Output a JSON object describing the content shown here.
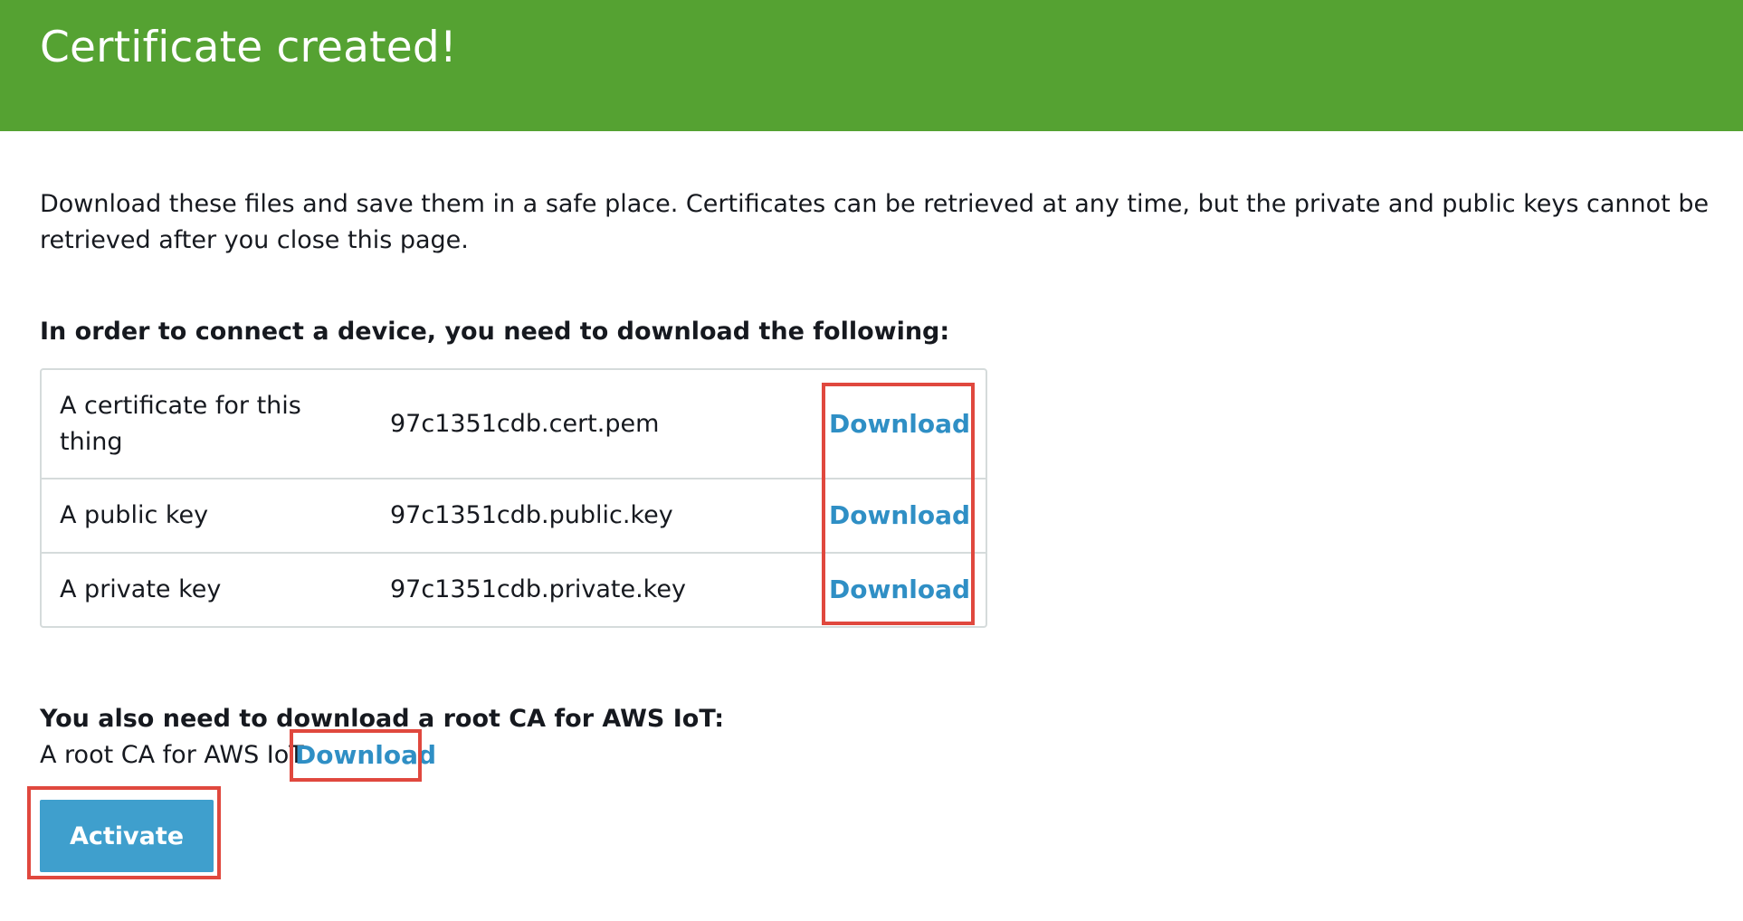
{
  "banner": {
    "title": "Certificate created!"
  },
  "intro": {
    "text": "Download these files and save them in a safe place. Certificates can be retrieved at any time, but the private and public keys cannot be retrieved after you close this page."
  },
  "device_section": {
    "heading": "In order to connect a device, you need to download the following:",
    "rows": [
      {
        "description": "A certificate for this thing",
        "filename": "97c1351cdb.cert.pem",
        "link": "Download"
      },
      {
        "description": "A public key",
        "filename": "97c1351cdb.public.key",
        "link": "Download"
      },
      {
        "description": "A private key",
        "filename": "97c1351cdb.private.key",
        "link": "Download"
      }
    ]
  },
  "root_ca": {
    "heading": "You also need to download a root CA for AWS IoT:",
    "label": "A root CA for AWS IoT",
    "link": "Download"
  },
  "actions": {
    "activate_label": "Activate"
  },
  "colors": {
    "banner": "#55a232",
    "link": "#2f8fc5",
    "button": "#3f9fcd",
    "highlight": "#e0483e"
  }
}
